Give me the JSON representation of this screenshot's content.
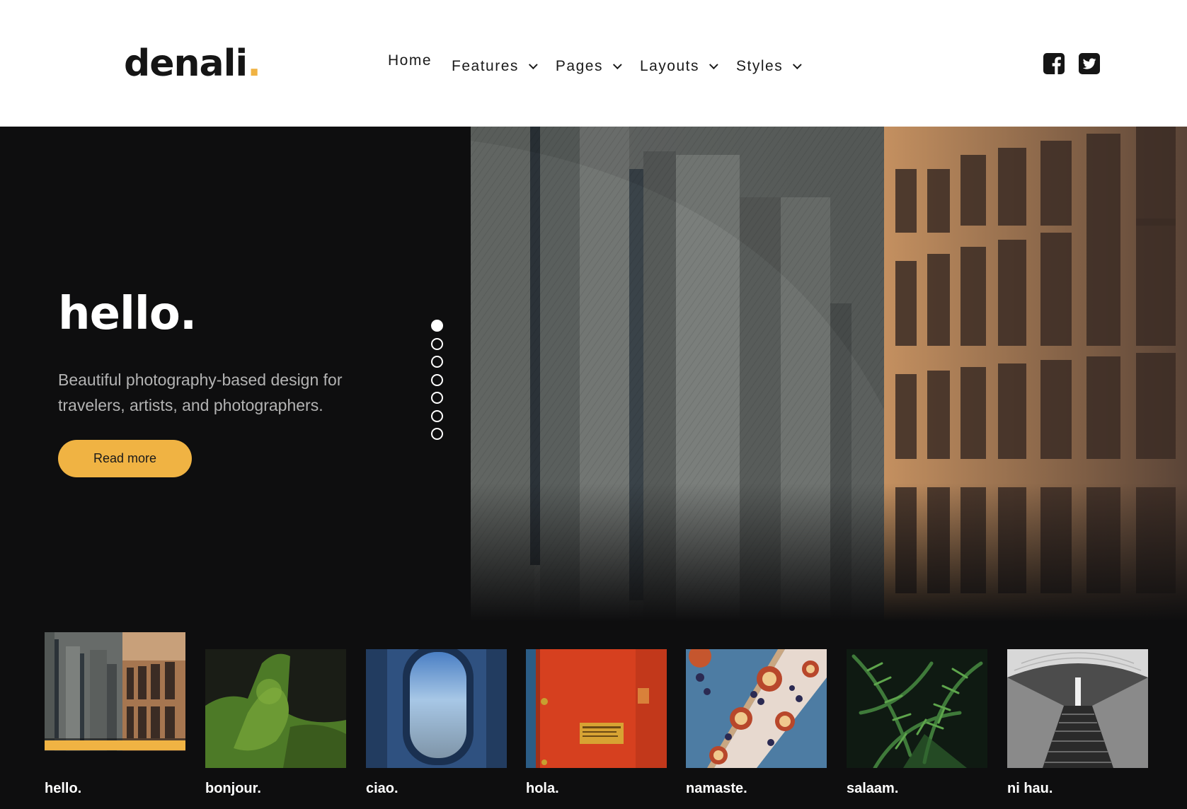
{
  "brand": {
    "name": "denali",
    "dot": "."
  },
  "nav": {
    "items": [
      {
        "label": "Home"
      },
      {
        "label": "Features"
      },
      {
        "label": "Pages"
      },
      {
        "label": "Layouts"
      },
      {
        "label": "Styles"
      }
    ]
  },
  "social": [
    "facebook-icon",
    "twitter-icon"
  ],
  "hero": {
    "title": "hello.",
    "subtitle": "Beautiful photography-based design for travelers, artists, and photographers.",
    "button_label": "Read more",
    "slide_count": 7,
    "active_slide": 1
  },
  "thumbnails": [
    {
      "label": "hello.",
      "active": true
    },
    {
      "label": "bonjour."
    },
    {
      "label": "ciao."
    },
    {
      "label": "hola."
    },
    {
      "label": "namaste."
    },
    {
      "label": "salaam."
    },
    {
      "label": "ni hau."
    }
  ],
  "colors": {
    "accent": "#f0b343",
    "background": "#0e0e0f",
    "header": "#ffffff"
  }
}
